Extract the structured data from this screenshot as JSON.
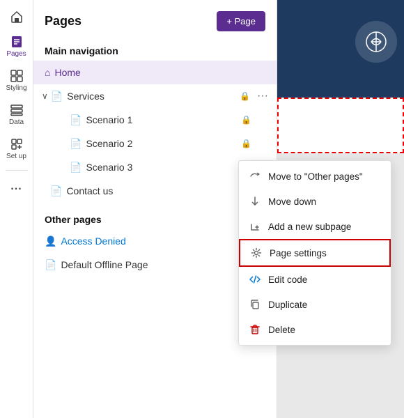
{
  "sidebar": {
    "home_label": "Home",
    "pages_label": "Pages",
    "styling_label": "Styling",
    "data_label": "Data",
    "setup_label": "Set up",
    "more_label": "..."
  },
  "header": {
    "title": "Pages",
    "add_button": "+ Page"
  },
  "main_nav": {
    "section_label": "Main navigation",
    "home_item": "Home",
    "services_item": "Services",
    "scenario1": "Scenario 1",
    "scenario2": "Scenario 2",
    "scenario3": "Scenario 3",
    "contact_us": "Contact us"
  },
  "other_pages": {
    "section_label": "Other pages",
    "access_denied": "Access Denied",
    "default_offline": "Default Offline Page"
  },
  "context_menu": {
    "move_to_other": "Move to \"Other pages\"",
    "move_down": "Move down",
    "add_subpage": "Add a new subpage",
    "page_settings": "Page settings",
    "edit_code": "Edit code",
    "duplicate": "Duplicate",
    "delete": "Delete"
  }
}
